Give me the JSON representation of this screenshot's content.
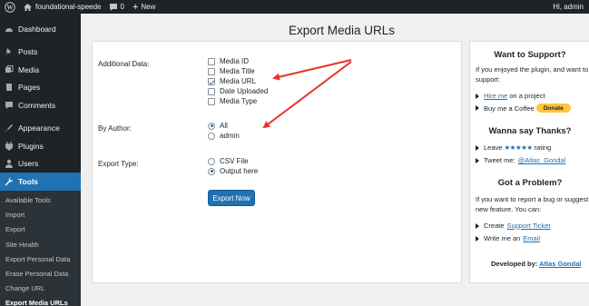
{
  "adminbar": {
    "site_name": "foundational-speede",
    "comments_count": "0",
    "new_label": "New",
    "greeting": "Hi, admin"
  },
  "sidebar": {
    "items": [
      {
        "label": "Dashboard",
        "icon": "dashboard-icon"
      },
      {
        "label": "Posts",
        "icon": "pin-icon"
      },
      {
        "label": "Media",
        "icon": "media-icon"
      },
      {
        "label": "Pages",
        "icon": "pages-icon"
      },
      {
        "label": "Comments",
        "icon": "comment-icon"
      },
      {
        "label": "Appearance",
        "icon": "brush-icon"
      },
      {
        "label": "Plugins",
        "icon": "plugin-icon"
      },
      {
        "label": "Users",
        "icon": "user-icon"
      },
      {
        "label": "Tools",
        "icon": "wrench-icon"
      }
    ],
    "submenu": [
      "Available Tools",
      "Import",
      "Export",
      "Site Health",
      "Export Personal Data",
      "Erase Personal Data",
      "Change URL",
      "Export Media URLs"
    ]
  },
  "main": {
    "title": "Export Media URLs",
    "additional_data_label": "Additional Data:",
    "additional_options": [
      {
        "label": "Media ID",
        "checked": false
      },
      {
        "label": "Media Title",
        "checked": false
      },
      {
        "label": "Media URL",
        "checked": true
      },
      {
        "label": "Date Uploaded",
        "checked": false
      },
      {
        "label": "Media Type",
        "checked": false
      }
    ],
    "by_author_label": "By Author:",
    "author_options": [
      {
        "label": "All",
        "checked": true
      },
      {
        "label": "admin",
        "checked": false
      }
    ],
    "export_type_label": "Export Type:",
    "export_options": [
      {
        "label": "CSV File",
        "checked": false
      },
      {
        "label": "Output here",
        "checked": true
      }
    ],
    "export_button": "Export Now"
  },
  "side": {
    "support_title": "Want to Support?",
    "support_text_1": "If you enjoyed the plugin, and want to",
    "support_text_2": "support:",
    "hire_link": "Hire me",
    "hire_rest": " on a project",
    "coffee_text": "Buy me a Coffee",
    "donate_label": "Donate",
    "thanks_title": "Wanna say Thanks?",
    "leave_text": "Leave",
    "stars": "★★★★★",
    "rating_text": "rating",
    "tweet_text": "Tweet me:",
    "tweet_link": "@Atlas_Gondal",
    "problem_title": "Got a Problem?",
    "problem_text_1": "If you want to report a bug or suggest a",
    "problem_text_2": "new feature. You can:",
    "create_text": "Create",
    "ticket_link": "Support Ticket",
    "write_text": "Write me an",
    "email_link": "Email",
    "developed_by": "Developed by:",
    "developer_link": "Atlas Gondal"
  },
  "colors": {
    "accent": "#2271b1",
    "admin_bar": "#1d2327",
    "arrow": "#e8342a",
    "donate": "#ffc439"
  }
}
